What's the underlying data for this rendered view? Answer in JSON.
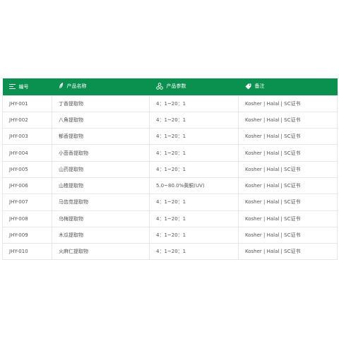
{
  "table": {
    "columns": [
      {
        "label": "编号",
        "icon": "list-icon"
      },
      {
        "label": "产品名称",
        "icon": "leaf-icon"
      },
      {
        "label": "产品参数",
        "icon": "molecule-icon"
      },
      {
        "label": "备注",
        "icon": "tag-icon"
      }
    ],
    "rows": [
      [
        "JHY-001",
        "丁香提取物",
        "4：1~20：1",
        "Kosher | Halal | SC证书"
      ],
      [
        "JHY-002",
        "八角提取物",
        "4：1~20：1",
        "Kosher | Halal | SC证书"
      ],
      [
        "JHY-003",
        "郁香提取物",
        "4：1~20：1",
        "Kosher | Halal | SC证书"
      ],
      [
        "JHY-004",
        "小茴香提取物",
        "4：1~20：1",
        "Kosher | Halal | SC证书"
      ],
      [
        "JHY-005",
        "山药提取物",
        "4：1~20：1",
        "Kosher | Halal | SC证书"
      ],
      [
        "JHY-006",
        "山楂提取物",
        "5.0~80.0%黄酮(UV)",
        "Kosher | Halal | SC证书"
      ],
      [
        "JHY-007",
        "马齿苋提取物",
        "4：1~20：1",
        "Kosher | Halal | SC证书"
      ],
      [
        "JHY-008",
        "乌梅提取物",
        "4：1~20：1",
        "Kosher | Halal | SC证书"
      ],
      [
        "JHY-009",
        "木瓜提取物",
        "4：1~20：1",
        "Kosher | Halal | SC证书"
      ],
      [
        "JHY-010",
        "火麻仁提取物",
        "4：1~20：1",
        "Kosher | Halal | SC证书"
      ]
    ]
  },
  "colors": {
    "header_bg": "#0a9150",
    "header_text": "#ffffff",
    "border": "#e6e6e6",
    "cell_text": "#555555"
  }
}
